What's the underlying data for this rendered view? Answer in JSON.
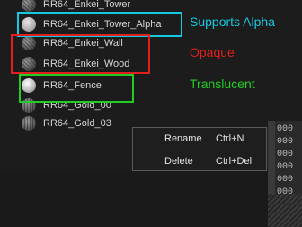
{
  "asset_list": {
    "items": [
      {
        "label": "RR64_Enkei_Tower"
      },
      {
        "label": "RR64_Enkei_Tower_Alpha"
      },
      {
        "label": "RR64_Enkei_Wall"
      },
      {
        "label": "RR64_Enkei_Wood"
      },
      {
        "label": "RR64_Fence"
      },
      {
        "label": "RR64_Gold_00"
      },
      {
        "label": "RR64_Gold_03"
      }
    ]
  },
  "annotations": {
    "alpha": {
      "text": "Supports Alpha",
      "color": "#16c8e0"
    },
    "opaque": {
      "text": "Opaque",
      "color": "#e01f1f"
    },
    "translucent": {
      "text": "Translucent",
      "color": "#22cc22"
    }
  },
  "context_menu": {
    "rename": {
      "label": "Rename",
      "shortcut": "Ctrl+N"
    },
    "delete": {
      "label": "Delete",
      "shortcut": "Ctrl+Del"
    }
  },
  "side_panel": {
    "values": [
      "000",
      "000",
      "000",
      "000",
      "000",
      "000",
      "000",
      "000"
    ]
  }
}
